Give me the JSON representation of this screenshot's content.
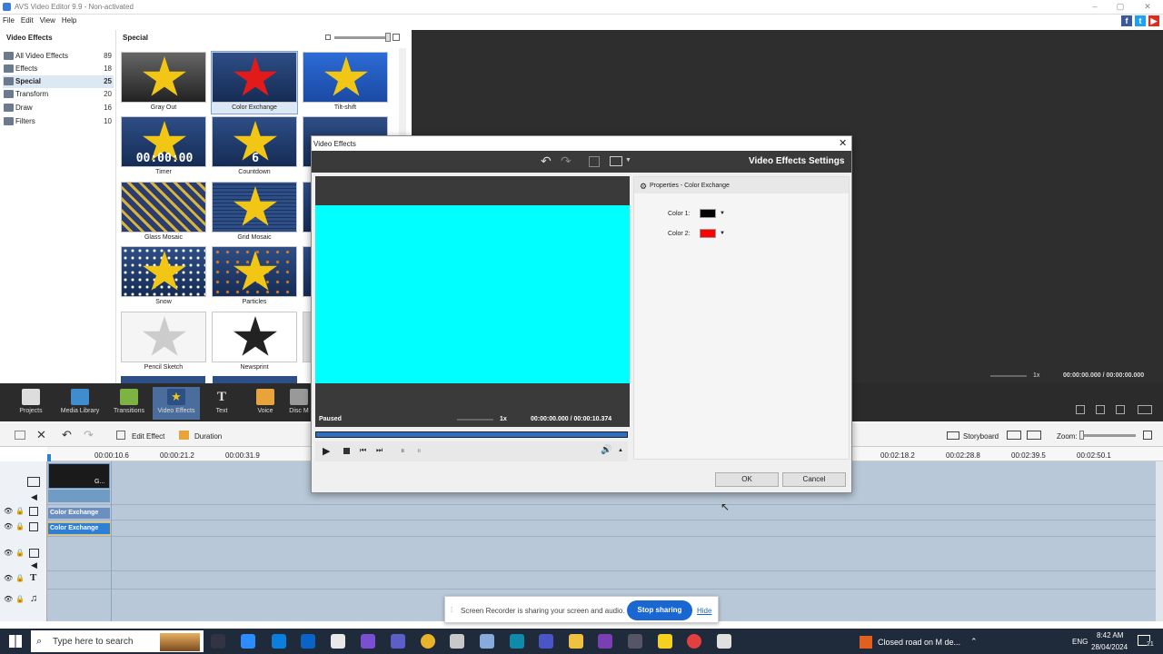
{
  "app": {
    "title": "AVS Video Editor 9.9 - Non-activated",
    "menu": [
      "File",
      "Edit",
      "View",
      "Help"
    ]
  },
  "left_panel": {
    "header": "Video Effects",
    "categories": [
      {
        "label": "All Video Effects",
        "count": "89"
      },
      {
        "label": "Effects",
        "count": "18"
      },
      {
        "label": "Special",
        "count": "25",
        "selected": true
      },
      {
        "label": "Transform",
        "count": "20"
      },
      {
        "label": "Draw",
        "count": "16"
      },
      {
        "label": "Filters",
        "count": "10"
      }
    ]
  },
  "grid": {
    "header": "Special",
    "tiles": [
      {
        "name": "Gray Out"
      },
      {
        "name": "Color Exchange"
      },
      {
        "name": "Tilt-shift"
      },
      {
        "name": "Timer",
        "overlay": "00:00:00"
      },
      {
        "name": "Countdown",
        "overlay": "6"
      },
      {
        "name": ""
      },
      {
        "name": "Glass Mosaic"
      },
      {
        "name": "Grid Mosaic"
      },
      {
        "name": ""
      },
      {
        "name": "Snow"
      },
      {
        "name": "Particles"
      },
      {
        "name": ""
      },
      {
        "name": "Pencil Sketch"
      },
      {
        "name": "Newsprint"
      },
      {
        "name": ""
      }
    ]
  },
  "preview": {
    "speed": "1x",
    "time": "00:00:00.000 / 00:00:00.000"
  },
  "nav": [
    {
      "label": "Projects"
    },
    {
      "label": "Media Library"
    },
    {
      "label": "Transitions"
    },
    {
      "label": "Video Effects"
    },
    {
      "label": "Text"
    },
    {
      "label": "Voice"
    },
    {
      "label": "Disc M"
    }
  ],
  "timeline": {
    "edit_effect": "Edit Effect",
    "duration": "Duration",
    "storyboard": "Storyboard",
    "zoom": "Zoom:",
    "ruler": [
      "00:00:10.6",
      "00:00:21.2",
      "00:00:31.9",
      "00:02:18.2",
      "00:02:28.8",
      "00:02:39.5",
      "00:02:50.1"
    ],
    "clip_label": "G...",
    "effect_clips": [
      "Color Exchange",
      "Color Exchange"
    ]
  },
  "dialog": {
    "title": "Video Effects",
    "settings_title": "Video Effects Settings",
    "status": "Paused",
    "speed": "1x",
    "time": "00:00:00.000 / 00:00:10.374",
    "properties_title": "Properties - Color Exchange",
    "color1_label": "Color 1:",
    "color2_label": "Color 2:",
    "color1": "#000000",
    "color2": "#ff0000",
    "ok": "OK",
    "cancel": "Cancel"
  },
  "share_bar": {
    "text": "Screen Recorder is sharing your screen and audio.",
    "stop": "Stop sharing",
    "hide": "Hide"
  },
  "taskbar": {
    "search_placeholder": "Type here to search",
    "notification": "Closed road on M de...",
    "lang": "ENG",
    "time": "8:42 AM",
    "date": "28/04/2024",
    "badge": "21"
  }
}
